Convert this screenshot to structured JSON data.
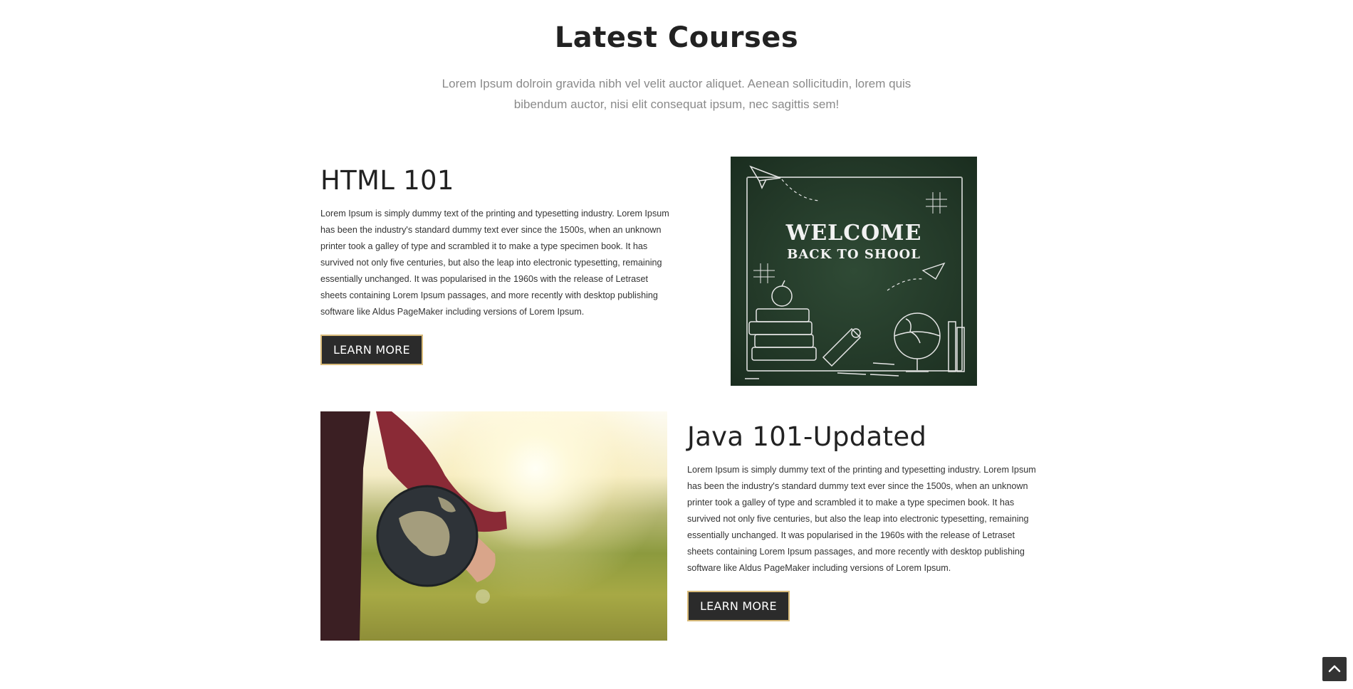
{
  "section": {
    "title": "Latest Courses",
    "subtitle": "Lorem Ipsum dolroin gravida nibh vel velit auctor aliquet. Aenean sollicitudin, lorem quis bibendum auctor, nisi elit consequat ipsum, nec sagittis sem!"
  },
  "courses": [
    {
      "title": "HTML 101",
      "description": "Lorem Ipsum is simply dummy text of the printing and typesetting industry. Lorem Ipsum has been the industry's standard dummy text ever since the 1500s, when an unknown printer took a galley of type and scrambled it to make a type specimen book. It has survived not only five centuries, but also the leap into electronic typesetting, remaining essentially unchanged. It was popularised in the 1960s with the release of Letraset sheets containing Lorem Ipsum passages, and more recently with desktop publishing software like Aldus PageMaker including versions of Lorem Ipsum.",
      "button_label": "LEARN MORE",
      "image": {
        "line1": "WELCOME",
        "line2": "BACK TO SHOOL"
      }
    },
    {
      "title": "Java 101-Updated",
      "description": "Lorem Ipsum is simply dummy text of the printing and typesetting industry. Lorem Ipsum has been the industry's standard dummy text ever since the 1500s, when an unknown printer took a galley of type and scrambled it to make a type specimen book. It has survived not only five centuries, but also the leap into electronic typesetting, remaining essentially unchanged. It was popularised in the 1960s with the release of Letraset sheets containing Lorem Ipsum passages, and more recently with desktop publishing software like Aldus PageMaker including versions of Lorem Ipsum.",
      "button_label": "LEARN MORE"
    }
  ],
  "scroll_top": {
    "icon": "chevron-up-icon"
  },
  "colors": {
    "button_bg": "#2b2b2b",
    "button_border": "#d9bb7a",
    "chalkboard": "#213626"
  }
}
